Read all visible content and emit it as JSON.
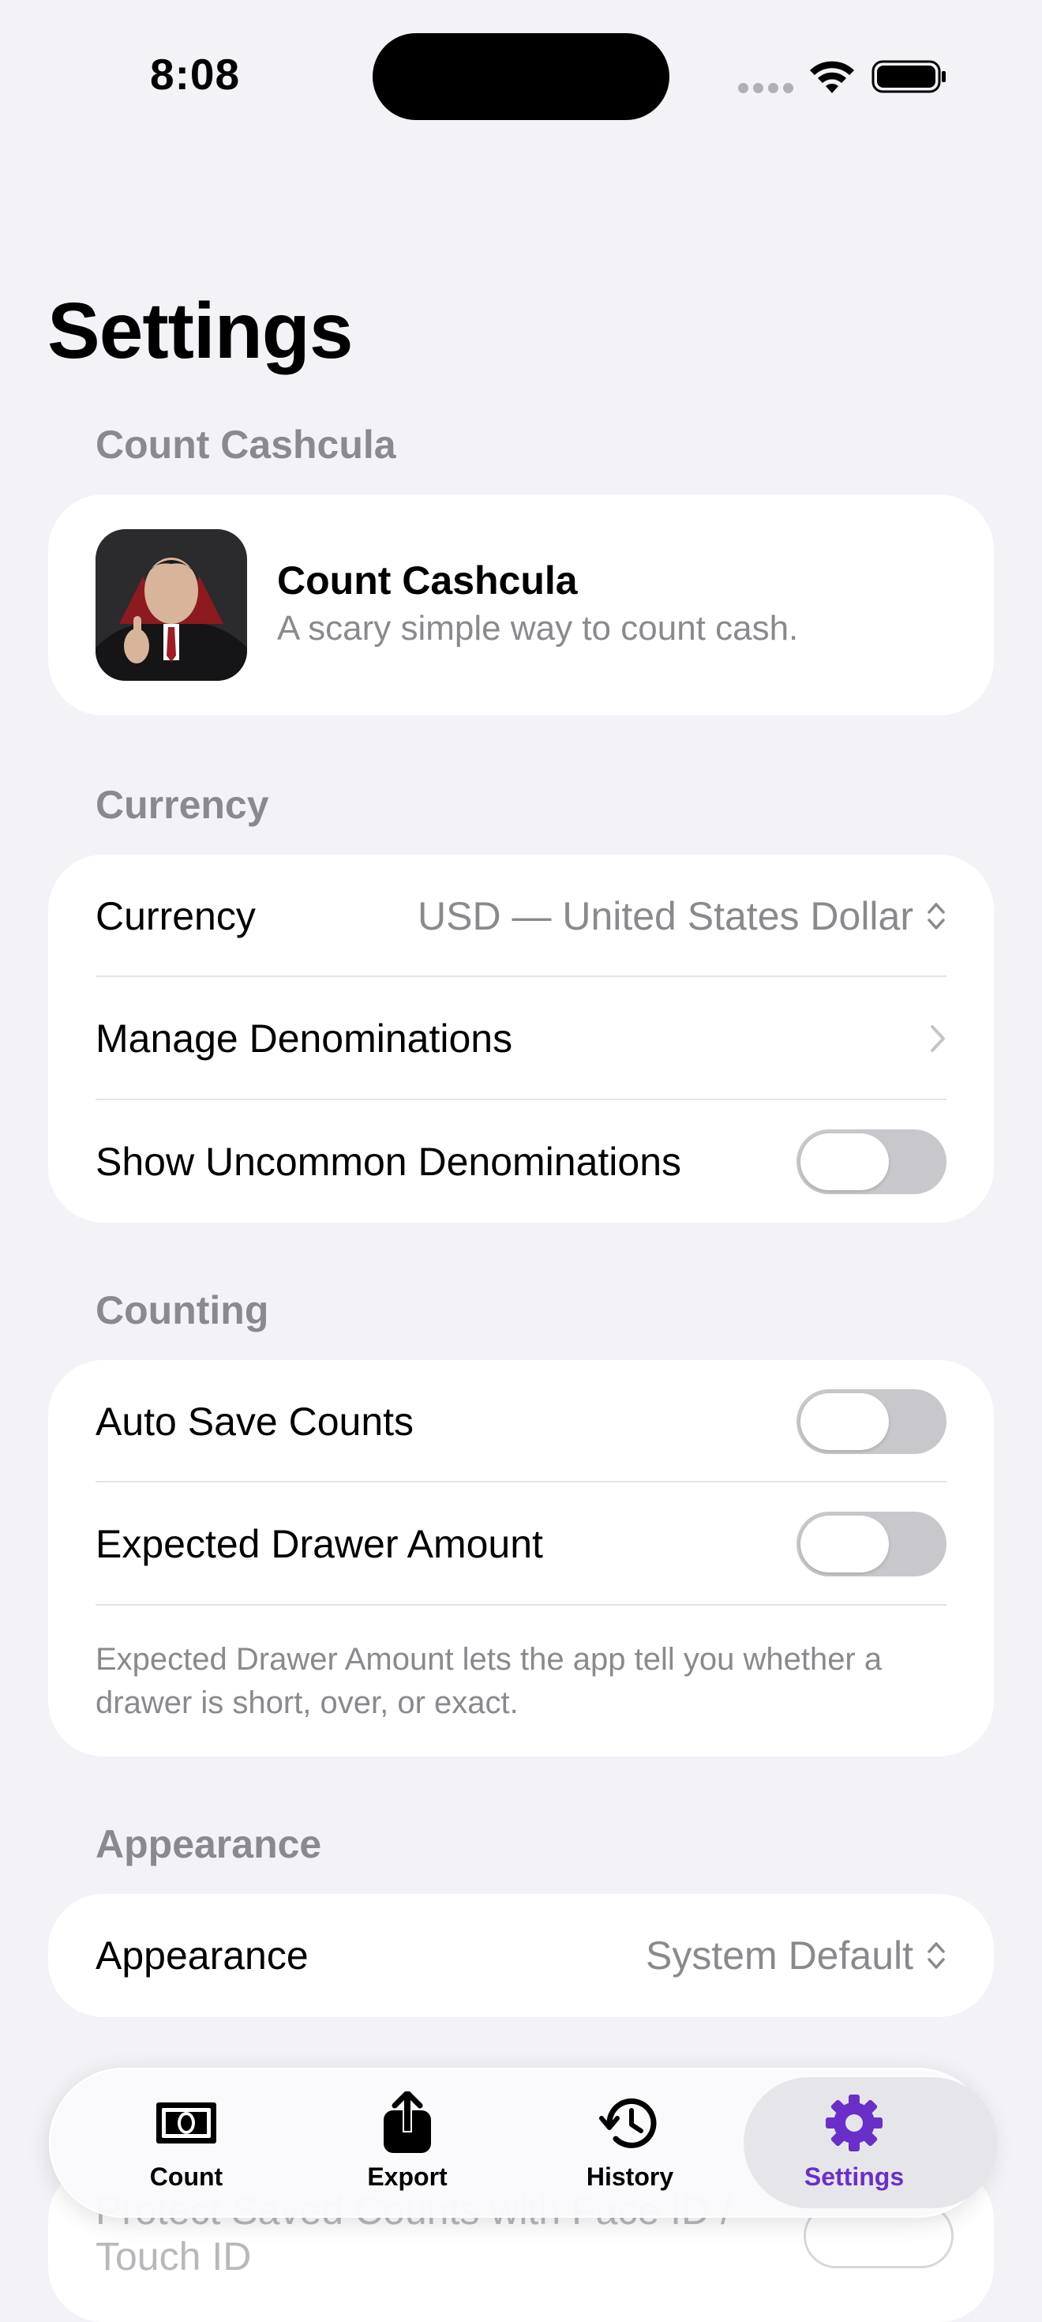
{
  "status_bar": {
    "time": "8:08"
  },
  "page": {
    "title": "Settings"
  },
  "about": {
    "header": "Count Cashcula",
    "app_name": "Count Cashcula",
    "tagline": "A scary simple way to count cash."
  },
  "currency": {
    "header": "Currency",
    "currency_label": "Currency",
    "currency_value": "USD — United States Dollar",
    "manage_label": "Manage Denominations",
    "uncommon_label": "Show Uncommon Denominations",
    "uncommon_on": false
  },
  "counting": {
    "header": "Counting",
    "autosave_label": "Auto Save Counts",
    "autosave_on": false,
    "expected_label": "Expected Drawer Amount",
    "expected_on": false,
    "footnote": "Expected Drawer Amount lets the app tell you whether a drawer is short, over, or exact."
  },
  "appearance": {
    "header": "Appearance",
    "label": "Appearance",
    "value": "System Default"
  },
  "security": {
    "protect_label": "Protect Saved Counts with Face ID / Touch ID"
  },
  "tab_bar": {
    "tabs": [
      {
        "label": "Count",
        "icon": "banknote-icon"
      },
      {
        "label": "Export",
        "icon": "share-icon"
      },
      {
        "label": "History",
        "icon": "history-icon"
      },
      {
        "label": "Settings",
        "icon": "gear-icon",
        "active": true
      }
    ],
    "accent_color": "#6a2fc9"
  }
}
